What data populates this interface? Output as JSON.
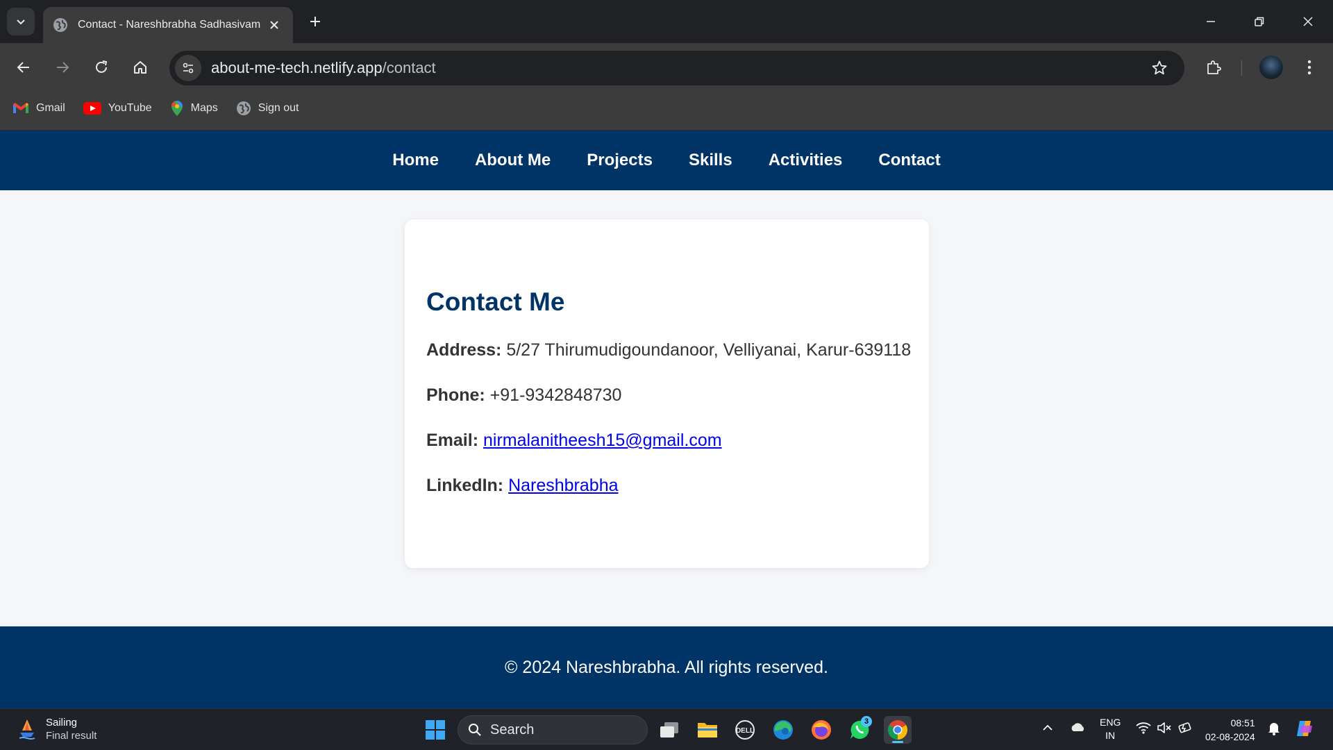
{
  "browser": {
    "tab_title": "Contact - Nareshbrabha Sadhasivam",
    "url_host": "about-me-tech.netlify.app",
    "url_path": "/contact",
    "bookmarks": [
      {
        "label": "Gmail",
        "icon": "gmail-icon"
      },
      {
        "label": "YouTube",
        "icon": "youtube-icon"
      },
      {
        "label": "Maps",
        "icon": "maps-icon"
      },
      {
        "label": "Sign out",
        "icon": "globe-icon"
      }
    ]
  },
  "site": {
    "nav": [
      "Home",
      "About Me",
      "Projects",
      "Skills",
      "Activities",
      "Contact"
    ],
    "contact": {
      "heading": "Contact Me",
      "address_label": "Address:",
      "address_value": "5/27 Thirumudigoundanoor, Velliyanai, Karur-639118",
      "phone_label": "Phone:",
      "phone_value": "+91-9342848730",
      "email_label": "Email:",
      "email_value": "nirmalanitheesh15@gmail.com",
      "linkedin_label": "LinkedIn:",
      "linkedin_value": "Nareshbrabha"
    },
    "footer": "© 2024 Nareshbrabha. All rights reserved."
  },
  "taskbar": {
    "weather_title": "Sailing",
    "weather_subtitle": "Final result",
    "search_label": "Search",
    "whatsapp_badge": "3",
    "lang_top": "ENG",
    "lang_bottom": "IN",
    "time": "08:51",
    "date": "02-08-2024"
  },
  "colors": {
    "nav_bg": "#003366",
    "heading": "#003366",
    "link": "#0000ee",
    "page_bg": "#f4f6f9"
  }
}
